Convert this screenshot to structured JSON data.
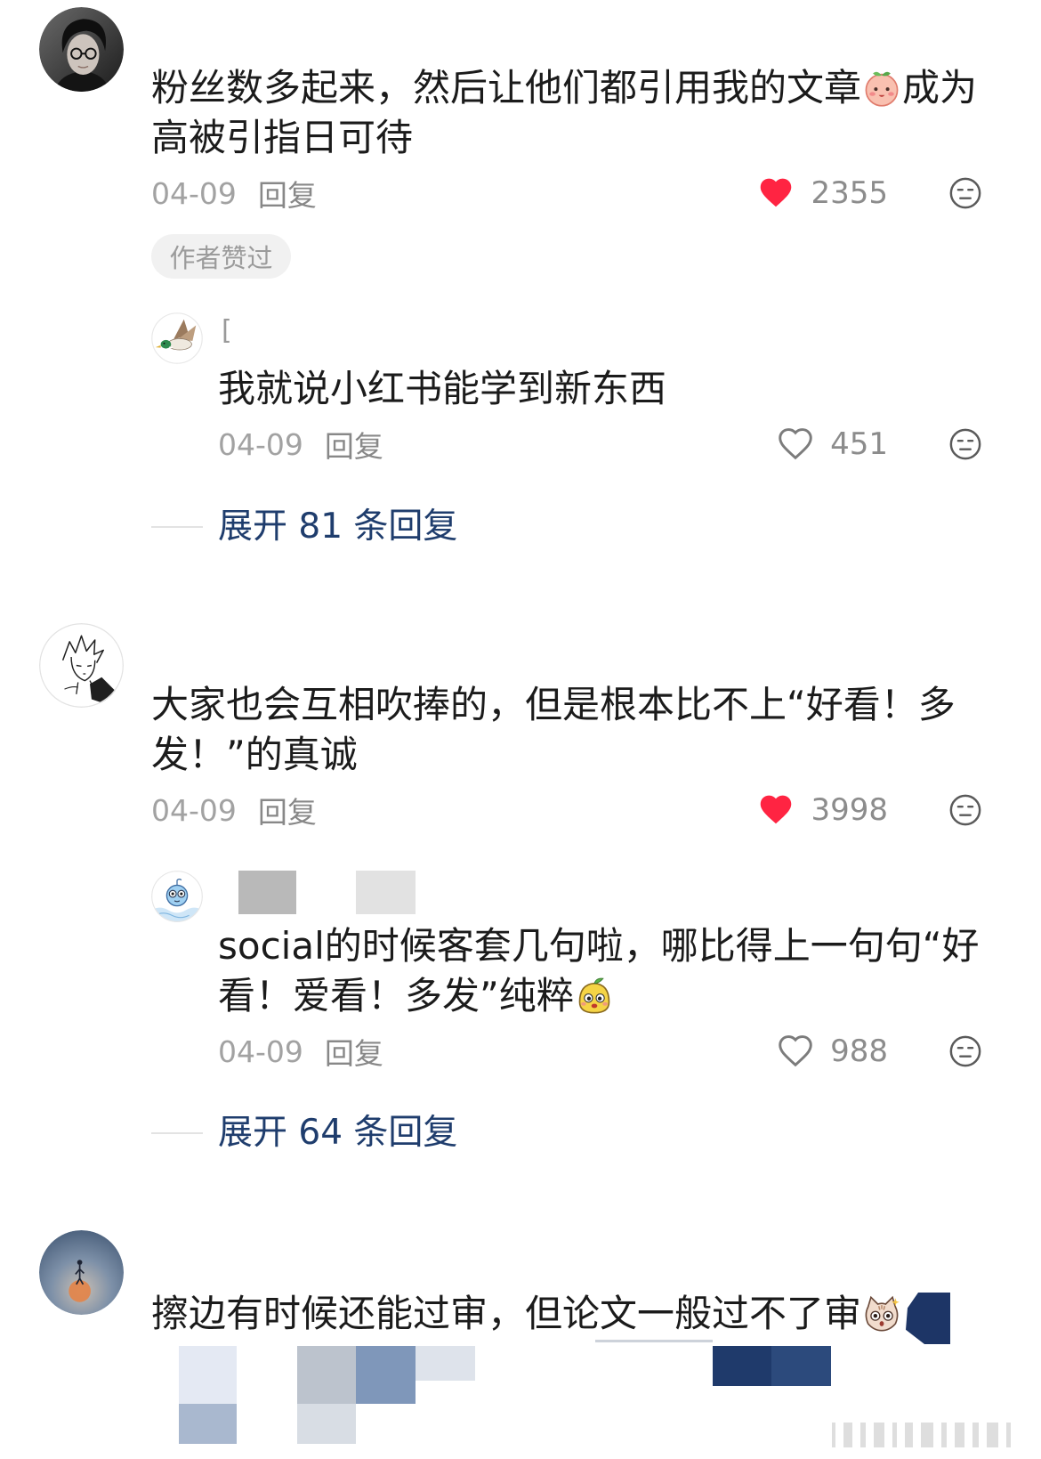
{
  "theme": {
    "text": "#1b1b1b",
    "meta": "#a2a2a2",
    "reply": "#888888",
    "like_red": "#ff2442",
    "expand_blue": "#1f3d6d",
    "badge_bg": "#f1f1f1",
    "badge_text": "#9b9b9b"
  },
  "icons": {
    "like_filled": "heart-filled-icon",
    "like_outline": "heart-outline-icon",
    "dislike": "dislike-face-icon"
  },
  "comments": [
    {
      "avatar_icon": "portrait-avatar",
      "lines": [
        [
          {
            "text": "粉丝数多起来，然后让他们都引用我的文章"
          },
          {
            "emoji": "peach-face-emoji"
          },
          {
            "text": "成为"
          }
        ],
        [
          {
            "text": "高被引指日可待"
          }
        ]
      ],
      "date": "04-09",
      "reply_label": "回复",
      "likes": "2355",
      "liked": true,
      "badge": "作者赞过",
      "replies": [
        {
          "avatar_icon": "mallard-duck-avatar",
          "username": "[",
          "lines": [
            [
              {
                "text": "我就说小红书能学到新东西"
              }
            ]
          ],
          "date": "04-09",
          "reply_label": "回复",
          "likes": "451",
          "liked": false
        }
      ],
      "expand_label": "展开 81 条回复"
    },
    {
      "avatar_icon": "manga-sketch-avatar",
      "lines": [
        [
          {
            "text": "大家也会互相吹捧的，但是根本比不上“好看！多"
          }
        ],
        [
          {
            "text": "发！”的真诚"
          }
        ]
      ],
      "date": "04-09",
      "reply_label": "回复",
      "likes": "3998",
      "liked": true,
      "replies": [
        {
          "avatar_icon": "blue-cartoon-avatar",
          "lines": [
            [
              {
                "text": "social的时候客套几句啦，哪比得上一句句“好"
              }
            ],
            [
              {
                "text": "看！爱看！多发”纯粹"
              },
              {
                "emoji": "yellow-blob-emoji"
              }
            ]
          ],
          "date": "04-09",
          "reply_label": "回复",
          "likes": "988",
          "liked": false
        }
      ],
      "expand_label": "展开 64 条回复"
    },
    {
      "avatar_icon": "moon-silhouette-avatar",
      "lines": [
        [
          {
            "text": "擦边有时候还能过审，但论文一般过不了审"
          },
          {
            "emoji": "cat-face-emoji"
          }
        ]
      ]
    }
  ]
}
